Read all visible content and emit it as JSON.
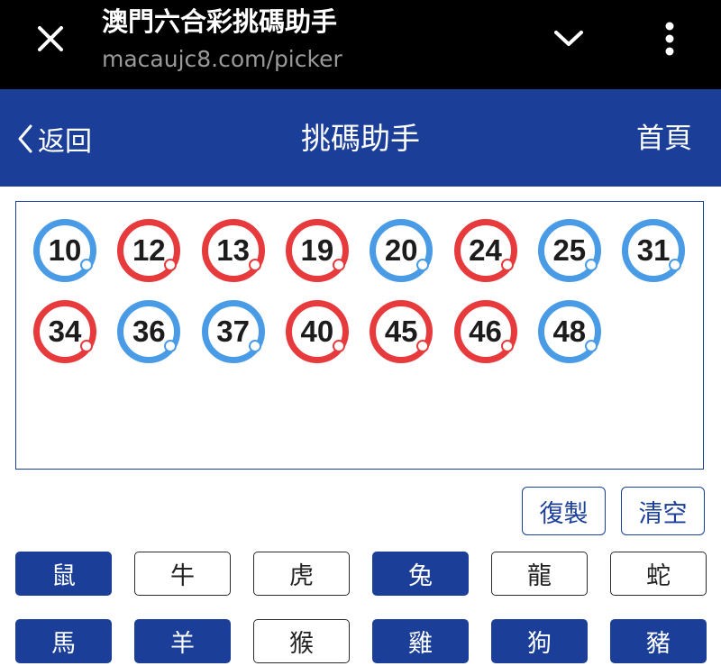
{
  "browser": {
    "title": "澳門六合彩挑碼助手",
    "url": "macaujc8.com/picker",
    "close_icon": "close-icon",
    "chevron_icon": "chevron-down-icon",
    "menu_icon": "more-vertical-icon"
  },
  "header": {
    "back_label": "返回",
    "title": "挑碼助手",
    "home_label": "首頁",
    "color": "#1b3f99"
  },
  "picked": [
    {
      "num": "10",
      "color": "blue"
    },
    {
      "num": "12",
      "color": "red"
    },
    {
      "num": "13",
      "color": "red"
    },
    {
      "num": "19",
      "color": "red"
    },
    {
      "num": "20",
      "color": "blue"
    },
    {
      "num": "24",
      "color": "red"
    },
    {
      "num": "25",
      "color": "blue"
    },
    {
      "num": "31",
      "color": "blue"
    },
    {
      "num": "34",
      "color": "red"
    },
    {
      "num": "36",
      "color": "blue"
    },
    {
      "num": "37",
      "color": "blue"
    },
    {
      "num": "40",
      "color": "red"
    },
    {
      "num": "45",
      "color": "red"
    },
    {
      "num": "46",
      "color": "red"
    },
    {
      "num": "48",
      "color": "blue"
    }
  ],
  "actions": {
    "copy_label": "復製",
    "clear_label": "清空"
  },
  "zodiac": [
    {
      "label": "鼠",
      "selected": true
    },
    {
      "label": "牛",
      "selected": false
    },
    {
      "label": "虎",
      "selected": false
    },
    {
      "label": "兔",
      "selected": true
    },
    {
      "label": "龍",
      "selected": false
    },
    {
      "label": "蛇",
      "selected": false
    },
    {
      "label": "馬",
      "selected": true
    },
    {
      "label": "羊",
      "selected": true
    },
    {
      "label": "猴",
      "selected": false
    },
    {
      "label": "雞",
      "selected": true
    },
    {
      "label": "狗",
      "selected": true
    },
    {
      "label": "豬",
      "selected": true
    }
  ],
  "colors": {
    "red_ball": "#e73a3c",
    "blue_ball": "#4a9be6",
    "accent": "#1b3f99"
  }
}
